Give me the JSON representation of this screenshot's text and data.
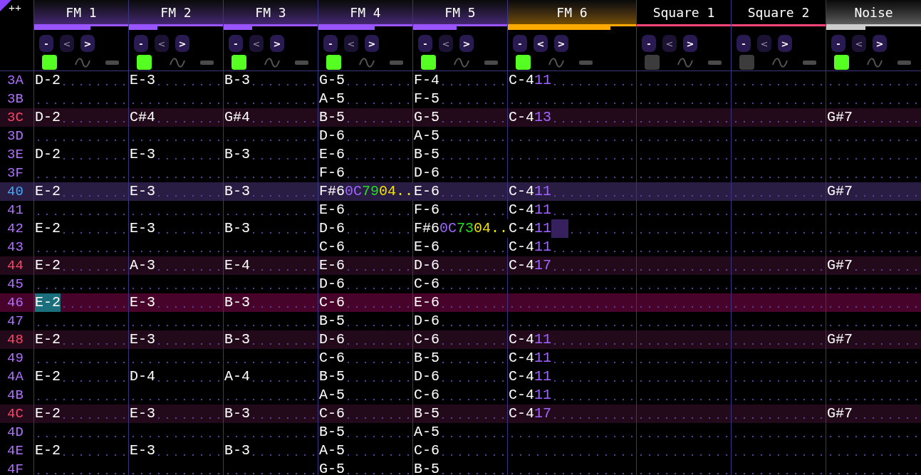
{
  "corner": {
    "label": "++"
  },
  "channels": [
    {
      "name": "FM 1",
      "kind": "fm",
      "color": "#9955ff",
      "level": 0.6,
      "expanded": false,
      "buttons": [
        "-",
        "<",
        ">"
      ],
      "prev_disabled": true,
      "on": true
    },
    {
      "name": "FM 2",
      "kind": "fm",
      "color": "#9955ff",
      "level": 0.3,
      "expanded": false,
      "buttons": [
        "-",
        "<",
        ">"
      ],
      "prev_disabled": true,
      "on": true
    },
    {
      "name": "FM 3",
      "kind": "fm",
      "color": "#9955ff",
      "level": 0.3,
      "expanded": false,
      "buttons": [
        "-",
        "<",
        ">"
      ],
      "prev_disabled": true,
      "on": true
    },
    {
      "name": "FM 4",
      "kind": "fm",
      "color": "#9955ff",
      "level": 0.6,
      "expanded": false,
      "buttons": [
        "-",
        "<",
        ">"
      ],
      "prev_disabled": true,
      "on": true
    },
    {
      "name": "FM 5",
      "kind": "fm",
      "color": "#9955ff",
      "level": 0.46,
      "expanded": false,
      "buttons": [
        "-",
        "<",
        ">"
      ],
      "prev_disabled": true,
      "on": true
    },
    {
      "name": "FM 6",
      "kind": "fm",
      "color": "#ffaa00",
      "level": 0.8,
      "expanded": true,
      "buttons": [
        "-",
        "<",
        ">"
      ],
      "prev_disabled": false,
      "on": true
    },
    {
      "name": "Square 1",
      "kind": "square",
      "color": "#ff4477",
      "expanded": false,
      "buttons": [
        "-",
        "<",
        ">"
      ],
      "prev_disabled": true,
      "on": false
    },
    {
      "name": "Square 2",
      "kind": "square",
      "color": "#ff4477",
      "expanded": false,
      "buttons": [
        "-",
        "<",
        ">"
      ],
      "prev_disabled": true,
      "on": false
    },
    {
      "name": "Noise",
      "kind": "noise",
      "color": "#cccccc",
      "level": 0.41,
      "expanded": false,
      "buttons": [
        "-",
        "<",
        ">"
      ],
      "prev_disabled": true,
      "on": true
    }
  ],
  "rows": [
    {
      "num": "3A",
      "kind": "normal",
      "cells": [
        {
          "note": "D-2"
        },
        {
          "note": "E-3"
        },
        {
          "note": "B-3"
        },
        {
          "note": "G-5"
        },
        {
          "note": "F-4"
        },
        {
          "note": "C-4",
          "ins": "11"
        },
        {},
        {},
        {}
      ]
    },
    {
      "num": "3B",
      "kind": "normal",
      "cells": [
        {},
        {},
        {},
        {
          "note": "A-5"
        },
        {
          "note": "F-5"
        },
        {},
        {},
        {},
        {}
      ]
    },
    {
      "num": "3C",
      "kind": "beat",
      "cells": [
        {
          "note": "D-2"
        },
        {
          "note": "C#4"
        },
        {
          "note": "G#4"
        },
        {
          "note": "B-5"
        },
        {
          "note": "G-5"
        },
        {
          "note": "C-4",
          "ins": "13"
        },
        {},
        {},
        {
          "note": "G#7"
        }
      ]
    },
    {
      "num": "3D",
      "kind": "normal",
      "cells": [
        {},
        {},
        {},
        {
          "note": "D-6"
        },
        {
          "note": "A-5"
        },
        {},
        {},
        {},
        {}
      ]
    },
    {
      "num": "3E",
      "kind": "normal",
      "cells": [
        {
          "note": "D-2"
        },
        {
          "note": "E-3"
        },
        {
          "note": "B-3"
        },
        {
          "note": "E-6"
        },
        {
          "note": "B-5"
        },
        {},
        {},
        {},
        {}
      ]
    },
    {
      "num": "3F",
      "kind": "normal",
      "cells": [
        {},
        {},
        {},
        {
          "note": "F-6"
        },
        {
          "note": "D-6"
        },
        {},
        {},
        {},
        {}
      ]
    },
    {
      "num": "40",
      "kind": "bar",
      "cells": [
        {
          "note": "E-2"
        },
        {
          "note": "E-3"
        },
        {
          "note": "B-3"
        },
        {
          "note": "F#6",
          "ins": "0C",
          "vol": "79",
          "fx": "04.."
        },
        {
          "note": "E-6"
        },
        {
          "note": "C-4",
          "ins": "11"
        },
        {},
        {},
        {
          "note": "G#7"
        }
      ]
    },
    {
      "num": "41",
      "kind": "normal",
      "cells": [
        {},
        {},
        {},
        {
          "note": "E-6"
        },
        {
          "note": "F-6"
        },
        {
          "note": "C-4",
          "ins": "11"
        },
        {},
        {},
        {}
      ]
    },
    {
      "num": "42",
      "kind": "normal",
      "cells": [
        {
          "note": "E-2"
        },
        {
          "note": "E-3"
        },
        {
          "note": "B-3"
        },
        {
          "note": "D-6"
        },
        {
          "note": "F#6",
          "ins": "0C",
          "vol": "73",
          "fx": "04.."
        },
        {
          "note": "C-4",
          "ins": "11",
          "selection": true
        },
        {},
        {},
        {}
      ]
    },
    {
      "num": "43",
      "kind": "normal",
      "cells": [
        {},
        {},
        {},
        {
          "note": "C-6"
        },
        {
          "note": "E-6"
        },
        {
          "note": "C-4",
          "ins": "11"
        },
        {},
        {},
        {}
      ]
    },
    {
      "num": "44",
      "kind": "beat",
      "cells": [
        {
          "note": "E-2"
        },
        {
          "note": "A-3"
        },
        {
          "note": "E-4"
        },
        {
          "note": "E-6"
        },
        {
          "note": "D-6"
        },
        {
          "note": "C-4",
          "ins": "17"
        },
        {},
        {},
        {
          "note": "G#7"
        }
      ]
    },
    {
      "num": "45",
      "kind": "normal",
      "cells": [
        {},
        {},
        {},
        {
          "note": "D-6"
        },
        {
          "note": "C-6"
        },
        {},
        {},
        {},
        {}
      ]
    },
    {
      "num": "46",
      "kind": "cursor",
      "cells": [
        {
          "note": "E-2",
          "cursor": true
        },
        {
          "note": "E-3"
        },
        {
          "note": "B-3"
        },
        {
          "note": "C-6"
        },
        {
          "note": "E-6"
        },
        {},
        {},
        {},
        {}
      ]
    },
    {
      "num": "47",
      "kind": "normal",
      "cells": [
        {},
        {},
        {},
        {
          "note": "B-5"
        },
        {
          "note": "D-6"
        },
        {},
        {},
        {},
        {}
      ]
    },
    {
      "num": "48",
      "kind": "beat",
      "cells": [
        {
          "note": "E-2"
        },
        {
          "note": "E-3"
        },
        {
          "note": "B-3"
        },
        {
          "note": "D-6"
        },
        {
          "note": "C-6"
        },
        {
          "note": "C-4",
          "ins": "11"
        },
        {},
        {},
        {
          "note": "G#7"
        }
      ]
    },
    {
      "num": "49",
      "kind": "normal",
      "cells": [
        {},
        {},
        {},
        {
          "note": "C-6"
        },
        {
          "note": "B-5"
        },
        {
          "note": "C-4",
          "ins": "11"
        },
        {},
        {},
        {}
      ]
    },
    {
      "num": "4A",
      "kind": "normal",
      "cells": [
        {
          "note": "E-2"
        },
        {
          "note": "D-4"
        },
        {
          "note": "A-4"
        },
        {
          "note": "B-5"
        },
        {
          "note": "D-6"
        },
        {
          "note": "C-4",
          "ins": "11"
        },
        {},
        {},
        {}
      ]
    },
    {
      "num": "4B",
      "kind": "normal",
      "cells": [
        {},
        {},
        {},
        {
          "note": "A-5"
        },
        {
          "note": "C-6"
        },
        {
          "note": "C-4",
          "ins": "11"
        },
        {},
        {},
        {}
      ]
    },
    {
      "num": "4C",
      "kind": "beat",
      "cells": [
        {
          "note": "E-2"
        },
        {
          "note": "E-3"
        },
        {
          "note": "B-3"
        },
        {
          "note": "C-6"
        },
        {
          "note": "B-5"
        },
        {
          "note": "C-4",
          "ins": "17"
        },
        {},
        {},
        {
          "note": "G#7"
        }
      ]
    },
    {
      "num": "4D",
      "kind": "normal",
      "cells": [
        {},
        {},
        {},
        {
          "note": "B-5"
        },
        {
          "note": "A-5"
        },
        {},
        {},
        {},
        {}
      ]
    },
    {
      "num": "4E",
      "kind": "normal",
      "cells": [
        {
          "note": "E-2"
        },
        {
          "note": "E-3"
        },
        {
          "note": "B-3"
        },
        {
          "note": "A-5"
        },
        {
          "note": "C-6"
        },
        {},
        {},
        {},
        {}
      ]
    },
    {
      "num": "4F",
      "kind": "normal",
      "cells": [
        {},
        {},
        {},
        {
          "note": "G-5"
        },
        {
          "note": "B-5"
        },
        {},
        {},
        {},
        {}
      ]
    }
  ]
}
